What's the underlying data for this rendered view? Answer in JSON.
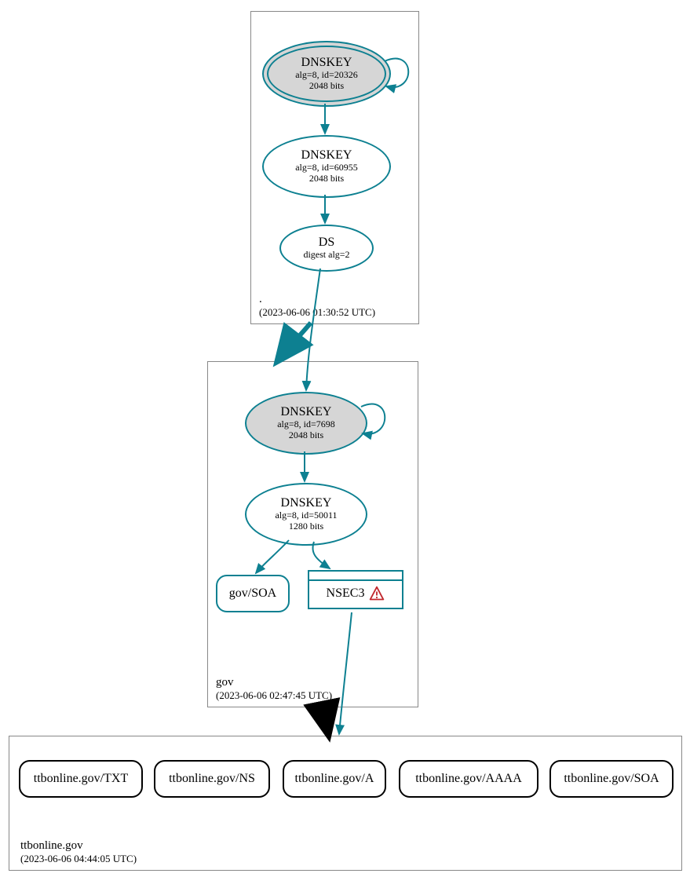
{
  "zones": {
    "root": {
      "label": ".",
      "timestamp": "(2023-06-06 01:30:52 UTC)",
      "dnskey1": {
        "title": "DNSKEY",
        "line1": "alg=8, id=20326",
        "line2": "2048 bits"
      },
      "dnskey2": {
        "title": "DNSKEY",
        "line1": "alg=8, id=60955",
        "line2": "2048 bits"
      },
      "ds": {
        "title": "DS",
        "line1": "digest alg=2"
      }
    },
    "gov": {
      "label": "gov",
      "timestamp": "(2023-06-06 02:47:45 UTC)",
      "dnskey1": {
        "title": "DNSKEY",
        "line1": "alg=8, id=7698",
        "line2": "2048 bits"
      },
      "dnskey2": {
        "title": "DNSKEY",
        "line1": "alg=8, id=50011",
        "line2": "1280 bits"
      },
      "soa": "gov/SOA",
      "nsec3": "NSEC3"
    },
    "leaf": {
      "label": "ttbonline.gov",
      "timestamp": "(2023-06-06 04:44:05 UTC)",
      "records": {
        "txt": "ttbonline.gov/TXT",
        "ns": "ttbonline.gov/NS",
        "a": "ttbonline.gov/A",
        "aaaa": "ttbonline.gov/AAAA",
        "soa": "ttbonline.gov/SOA"
      }
    }
  }
}
